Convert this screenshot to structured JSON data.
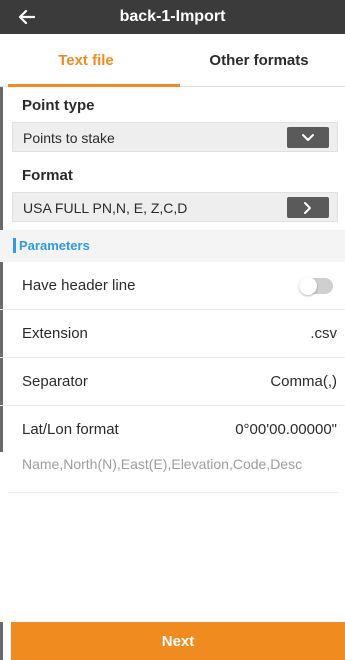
{
  "header": {
    "title": "back-1-Import",
    "back_icon": "arrow-left-icon"
  },
  "tabs": [
    {
      "label": "Text file",
      "active": true
    },
    {
      "label": "Other formats",
      "active": false
    }
  ],
  "point_type": {
    "label": "Point type",
    "value": "Points to stake",
    "icon": "chevron-down-icon"
  },
  "format": {
    "label": "Format",
    "value": "USA FULL PN,N, E, Z,C,D",
    "icon": "chevron-right-icon"
  },
  "parameters": {
    "section_label": "Parameters",
    "header_line": {
      "label": "Have header line",
      "enabled": false
    },
    "extension": {
      "label": "Extension",
      "value": ".csv"
    },
    "separator": {
      "label": "Separator",
      "value": "Comma(,)"
    },
    "latlon": {
      "label": "Lat/Lon format",
      "value": "0°00'00.00000\""
    }
  },
  "preview": "Name,North(N),East(E),Elevation,Code,Desc",
  "next_button": "Next",
  "colors": {
    "accent": "#f08b1f",
    "header_bg": "#3b3b3b",
    "section_blue": "#2e9ae8"
  }
}
